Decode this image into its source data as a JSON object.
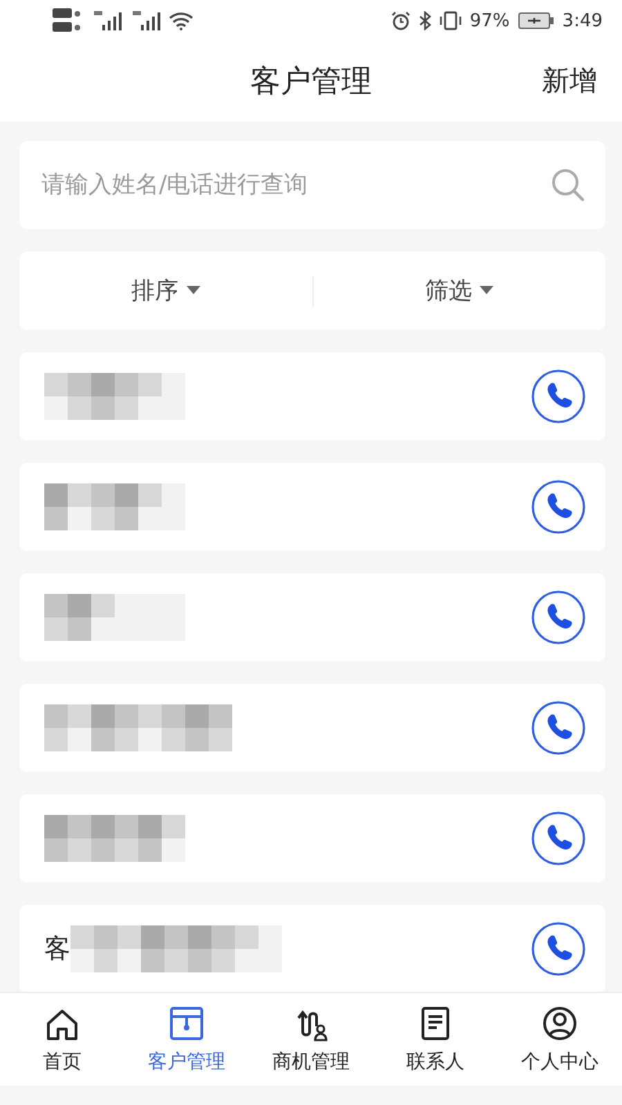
{
  "status_bar": {
    "battery": "97%",
    "time": "3:49"
  },
  "header": {
    "title": "客户管理",
    "action": "新增"
  },
  "search": {
    "placeholder": "请输入姓名/电话进行查询"
  },
  "filters": [
    {
      "label": "排序"
    },
    {
      "label": "筛选"
    }
  ],
  "customers": [
    {
      "blurred": true
    },
    {
      "blurred": true
    },
    {
      "blurred": true
    },
    {
      "blurred": true
    },
    {
      "blurred": true
    },
    {
      "name": "客",
      "blurred": true
    }
  ],
  "nav": [
    {
      "kind": "home",
      "label": "首页",
      "selected": false
    },
    {
      "kind": "customer",
      "label": "客户管理",
      "selected": true
    },
    {
      "kind": "deal",
      "label": "商机管理",
      "selected": false
    },
    {
      "kind": "contact",
      "label": "联系人",
      "selected": false
    },
    {
      "kind": "profile",
      "label": "个人中心",
      "selected": false
    }
  ]
}
